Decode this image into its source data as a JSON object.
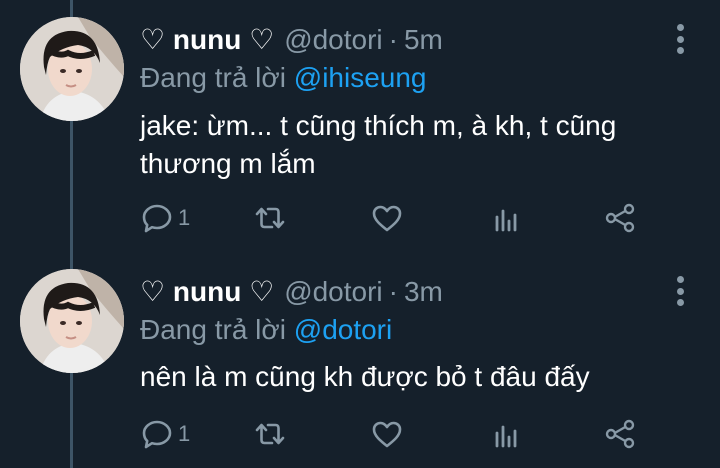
{
  "tweets": [
    {
      "display_name": "♡ nunu ♡",
      "handle": "@dotori",
      "separator": "·",
      "time": "5m",
      "reply_prefix": "Đang trả lời ",
      "reply_to": "@ihiseung",
      "text": "jake: ừm... t cũng thích m, à kh, t cũng thương m lắm",
      "reply_count": "1"
    },
    {
      "display_name": "♡ nunu ♡",
      "handle": "@dotori",
      "separator": "·",
      "time": "3m",
      "reply_prefix": "Đang trả lời ",
      "reply_to": "@dotori",
      "text": "nên là m cũng kh được bỏ t đâu đấy",
      "reply_count": "1"
    }
  ],
  "icons": {
    "reply": "reply-icon",
    "retweet": "retweet-icon",
    "like": "heart-icon",
    "stats": "analytics-icon",
    "share": "share-icon",
    "more": "more-vertical-icon"
  },
  "colors": {
    "background": "#15202b",
    "primary_text": "#ffffff",
    "secondary_text": "#8899a6",
    "accent": "#1da1f2",
    "thread_line": "#3d5466"
  }
}
